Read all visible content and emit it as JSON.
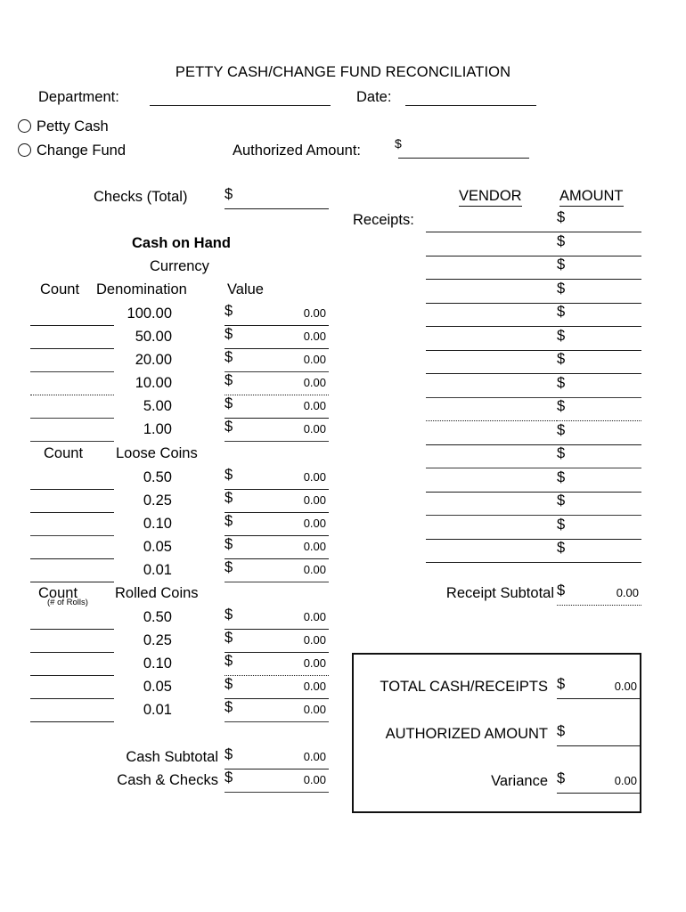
{
  "document": {
    "title": "PETTY CASH/CHANGE FUND RECONCILIATION"
  },
  "header": {
    "department_label": "Department:",
    "department_value": "",
    "date_label": "Date:",
    "date_value": "",
    "petty_cash_label": "Petty Cash",
    "change_fund_label": "Change Fund",
    "authorized_amount_label": "Authorized Amount:",
    "authorized_amount_symbol": "$",
    "authorized_amount_value": ""
  },
  "checks": {
    "label": "Checks (Total)",
    "symbol": "$",
    "value": ""
  },
  "cash_on_hand": {
    "section_title": "Cash on Hand",
    "currency_title": "Currency",
    "count_header": "Count",
    "denomination_header": "Denomination",
    "value_header": "Value",
    "currency_rows": [
      {
        "count": "",
        "denomination": "100.00",
        "symbol": "$",
        "value": "0.00"
      },
      {
        "count": "",
        "denomination": "50.00",
        "symbol": "$",
        "value": "0.00"
      },
      {
        "count": "",
        "denomination": "20.00",
        "symbol": "$",
        "value": "0.00"
      },
      {
        "count": "",
        "denomination": "10.00",
        "symbol": "$",
        "value": "0.00"
      },
      {
        "count": "",
        "denomination": "5.00",
        "symbol": "$",
        "value": "0.00"
      },
      {
        "count": "",
        "denomination": "1.00",
        "symbol": "$",
        "value": "0.00"
      }
    ],
    "loose_coins_count_header": "Count",
    "loose_coins_title": "Loose Coins",
    "loose_coin_rows": [
      {
        "count": "",
        "denomination": "0.50",
        "symbol": "$",
        "value": "0.00"
      },
      {
        "count": "",
        "denomination": "0.25",
        "symbol": "$",
        "value": "0.00"
      },
      {
        "count": "",
        "denomination": "0.10",
        "symbol": "$",
        "value": "0.00"
      },
      {
        "count": "",
        "denomination": "0.05",
        "symbol": "$",
        "value": "0.00"
      },
      {
        "count": "",
        "denomination": "0.01",
        "symbol": "$",
        "value": "0.00"
      }
    ],
    "rolled_coins_count_header": "Count",
    "rolled_coins_count_sub": "(# of Rolls)",
    "rolled_coins_title": "Rolled Coins",
    "rolled_coin_rows": [
      {
        "count": "",
        "denomination": "0.50",
        "symbol": "$",
        "value": "0.00"
      },
      {
        "count": "",
        "denomination": "0.25",
        "symbol": "$",
        "value": "0.00"
      },
      {
        "count": "",
        "denomination": "0.10",
        "symbol": "$",
        "value": "0.00"
      },
      {
        "count": "",
        "denomination": "0.05",
        "symbol": "$",
        "value": "0.00"
      },
      {
        "count": "",
        "denomination": "0.01",
        "symbol": "$",
        "value": "0.00"
      }
    ],
    "cash_subtotal_label": "Cash Subtotal",
    "cash_subtotal_symbol": "$",
    "cash_subtotal_value": "0.00",
    "cash_and_checks_label": "Cash & Checks",
    "cash_and_checks_symbol": "$",
    "cash_and_checks_value": "0.00"
  },
  "receipts": {
    "label": "Receipts:",
    "vendor_header": "VENDOR",
    "amount_header": "AMOUNT",
    "rows": [
      {
        "vendor": "",
        "symbol": "$",
        "amount": ""
      },
      {
        "vendor": "",
        "symbol": "$",
        "amount": ""
      },
      {
        "vendor": "",
        "symbol": "$",
        "amount": ""
      },
      {
        "vendor": "",
        "symbol": "$",
        "amount": ""
      },
      {
        "vendor": "",
        "symbol": "$",
        "amount": ""
      },
      {
        "vendor": "",
        "symbol": "$",
        "amount": ""
      },
      {
        "vendor": "",
        "symbol": "$",
        "amount": ""
      },
      {
        "vendor": "",
        "symbol": "$",
        "amount": ""
      },
      {
        "vendor": "",
        "symbol": "$",
        "amount": ""
      },
      {
        "vendor": "",
        "symbol": "$",
        "amount": ""
      },
      {
        "vendor": "",
        "symbol": "$",
        "amount": ""
      },
      {
        "vendor": "",
        "symbol": "$",
        "amount": ""
      },
      {
        "vendor": "",
        "symbol": "$",
        "amount": ""
      },
      {
        "vendor": "",
        "symbol": "$",
        "amount": ""
      },
      {
        "vendor": "",
        "symbol": "$",
        "amount": ""
      }
    ],
    "subtotal_label": "Receipt Subtotal",
    "subtotal_symbol": "$",
    "subtotal_value": "0.00"
  },
  "summary": {
    "total_label": "TOTAL CASH/RECEIPTS",
    "total_symbol": "$",
    "total_value": "0.00",
    "authorized_label": "AUTHORIZED AMOUNT",
    "authorized_symbol": "$",
    "authorized_value": "",
    "variance_label": "Variance",
    "variance_symbol": "$",
    "variance_value": "0.00"
  }
}
